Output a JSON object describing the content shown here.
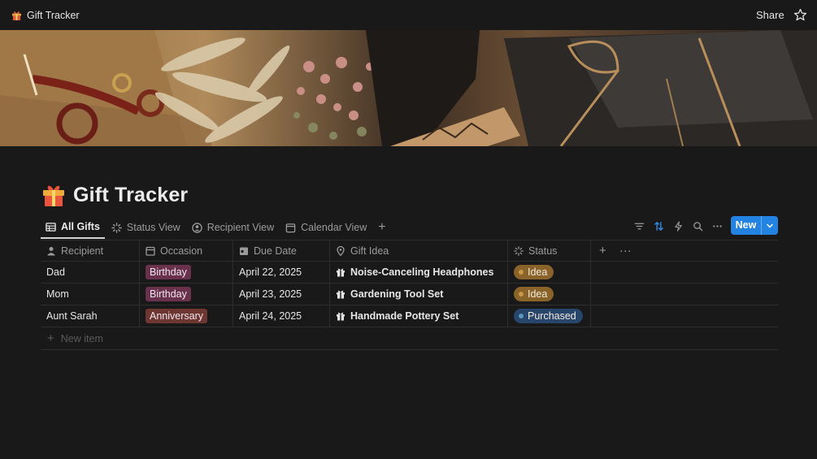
{
  "topbar": {
    "breadcrumb": "Gift Tracker",
    "share_label": "Share"
  },
  "page": {
    "title": "Gift Tracker",
    "icon": "wrapped-gift-emoji"
  },
  "tabs": [
    {
      "label": "All Gifts",
      "icon": "table-icon",
      "active": true
    },
    {
      "label": "Status View",
      "icon": "loading-icon",
      "active": false
    },
    {
      "label": "Recipient View",
      "icon": "person-circle-icon",
      "active": false
    },
    {
      "label": "Calendar View",
      "icon": "calendar-icon",
      "active": false
    }
  ],
  "toolbar": {
    "new_label": "New"
  },
  "table": {
    "columns": [
      {
        "label": "Recipient",
        "icon": "person-icon"
      },
      {
        "label": "Occasion",
        "icon": "calendar-icon"
      },
      {
        "label": "Due Date",
        "icon": "calendar-day-icon"
      },
      {
        "label": "Gift Idea",
        "icon": "location-pin-icon"
      },
      {
        "label": "Status",
        "icon": "loading-icon"
      }
    ],
    "rows": [
      {
        "recipient": "Dad",
        "occasion": "Birthday",
        "due_date": "April 22, 2025",
        "gift_idea": "Noise-Canceling Headphones",
        "status": "Idea"
      },
      {
        "recipient": "Mom",
        "occasion": "Birthday",
        "due_date": "April 23, 2025",
        "gift_idea": "Gardening Tool Set",
        "status": "Idea"
      },
      {
        "recipient": "Aunt Sarah",
        "occasion": "Anniversary",
        "due_date": "April 24, 2025",
        "gift_idea": "Handmade Pottery Set",
        "status": "Purchased"
      }
    ],
    "new_item_label": "New item"
  },
  "colors": {
    "accent": "#2383e2",
    "background": "#191919",
    "tag_birthday": "#69314c",
    "tag_anniversary": "#6e3630",
    "status_idea": "#89632a",
    "status_purchased": "#28456c"
  }
}
